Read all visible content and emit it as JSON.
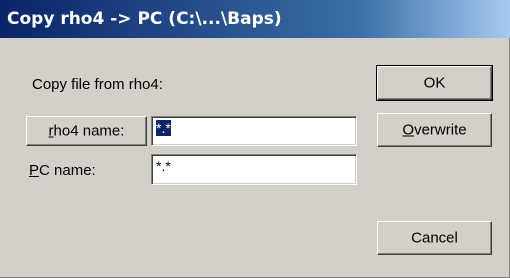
{
  "window": {
    "title": "Copy rho4 -> PC (C:\\...\\Baps)"
  },
  "labels": {
    "copy_from": "Copy file from rho4:",
    "pc_name_prefix": "P",
    "pc_name_rest": "C name:"
  },
  "rho4_button": {
    "label_prefix": "r",
    "label_rest": "ho4 name:"
  },
  "fields": {
    "rho4_name_value": "*.*",
    "rho4_name_selected": true,
    "pc_name_value": "*.*"
  },
  "buttons": {
    "ok_label": "OK",
    "overwrite_prefix": "O",
    "overwrite_rest": "verwrite",
    "cancel_label": "Cancel"
  }
}
